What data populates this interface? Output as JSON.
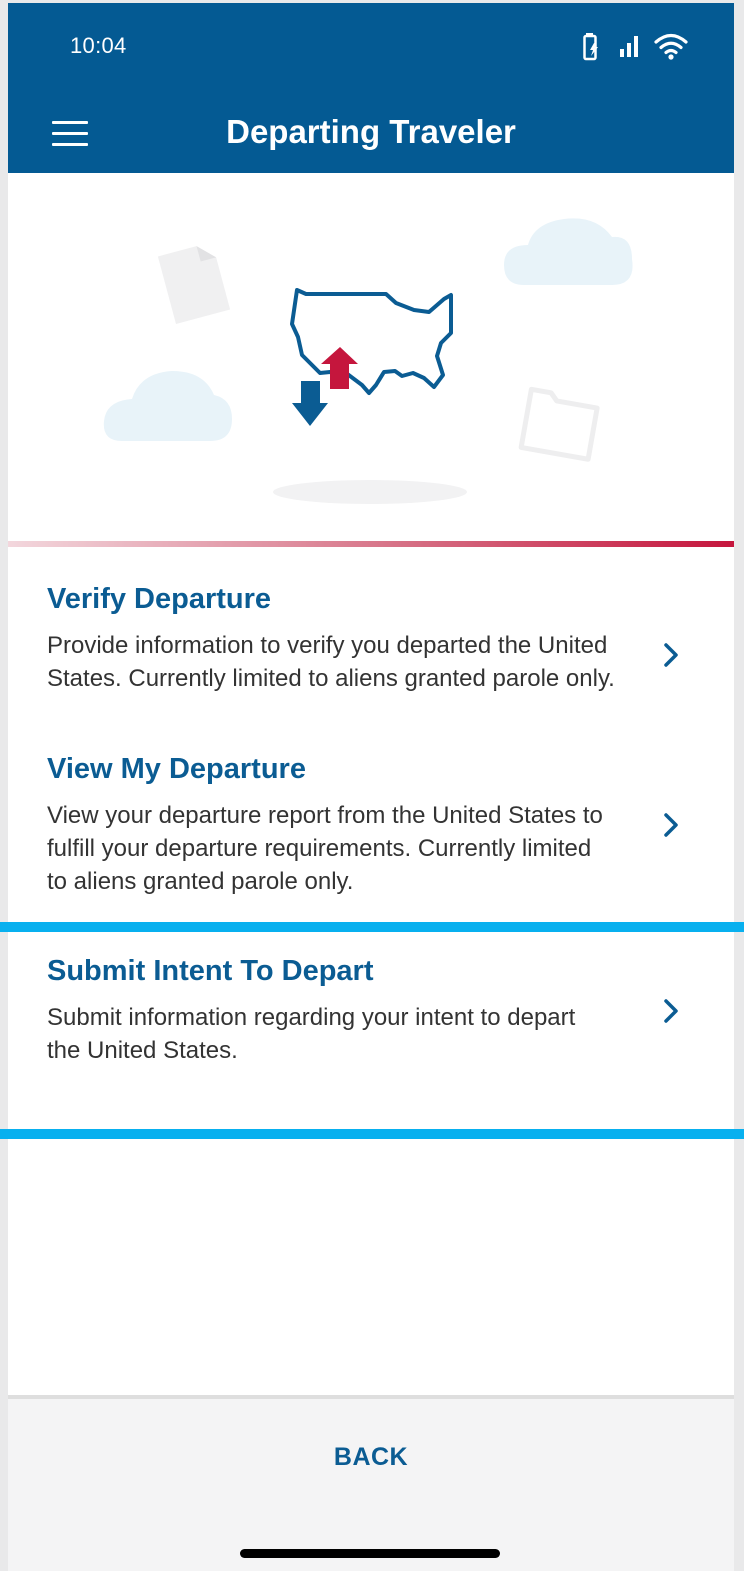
{
  "status_bar": {
    "time": "10:04",
    "icons": [
      "battery-charging-icon",
      "cellular-signal-icon",
      "wifi-icon"
    ]
  },
  "app_bar": {
    "title": "Departing Traveler",
    "menu_icon": "hamburger-menu-icon"
  },
  "hero": {
    "illustration": [
      "document-icon",
      "cloud-icon",
      "us-map-icon",
      "arrow-up-icon",
      "arrow-down-icon",
      "folder-icon"
    ]
  },
  "menu_items": [
    {
      "title": "Verify Departure",
      "description": "Provide information to verify you departed the United States. Currently limited to aliens granted parole only.",
      "icon": "chevron-right-icon"
    },
    {
      "title": "View My Departure",
      "description": "View your departure report from the United States to fulfill your departure requirements. Currently limited to aliens granted parole only.",
      "icon": "chevron-right-icon"
    },
    {
      "title": "Submit Intent To Depart",
      "description": "Submit information regarding your intent to depart the United States.",
      "icon": "chevron-right-icon"
    }
  ],
  "footer": {
    "back_label": "BACK"
  },
  "colors": {
    "brand_blue": "#045a93",
    "title_blue": "#0b5c93",
    "accent_red": "#c5163d",
    "highlight_cyan": "#08b0ef"
  }
}
